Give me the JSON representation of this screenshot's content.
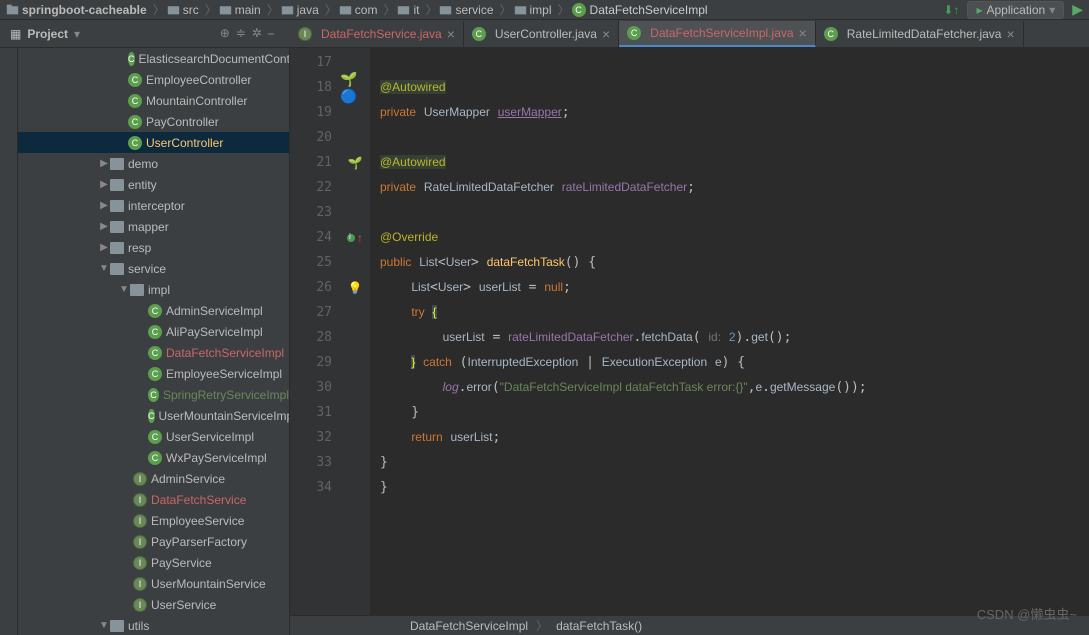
{
  "breadcrumbs": [
    "springboot-cacheable",
    "src",
    "main",
    "java",
    "com",
    "it",
    "service",
    "impl",
    "DataFetchServiceImpl"
  ],
  "runConfig": "Application",
  "projectTool": "Project",
  "tree": [
    {
      "ind": 110,
      "ic": "c",
      "lbl": "ElasticsearchDocumentController",
      "cls": ""
    },
    {
      "ind": 110,
      "ic": "c",
      "lbl": "EmployeeController",
      "cls": ""
    },
    {
      "ind": 110,
      "ic": "c",
      "lbl": "MountainController",
      "cls": ""
    },
    {
      "ind": 110,
      "ic": "c",
      "lbl": "PayController",
      "cls": ""
    },
    {
      "ind": 110,
      "ic": "c",
      "lbl": "UserController",
      "cls": "hl",
      "sel": true
    },
    {
      "ind": 80,
      "ic": "arr",
      "lbl": "demo",
      "fold": true
    },
    {
      "ind": 80,
      "ic": "arr",
      "lbl": "entity",
      "fold": true
    },
    {
      "ind": 80,
      "ic": "arr",
      "lbl": "interceptor",
      "fold": true
    },
    {
      "ind": 80,
      "ic": "arr",
      "lbl": "mapper",
      "fold": true
    },
    {
      "ind": 80,
      "ic": "arr",
      "lbl": "resp",
      "fold": true
    },
    {
      "ind": 80,
      "ic": "arrd",
      "lbl": "service",
      "fold": true
    },
    {
      "ind": 100,
      "ic": "arrd",
      "lbl": "impl",
      "fold": true
    },
    {
      "ind": 130,
      "ic": "c",
      "lbl": "AdminServiceImpl",
      "cls": ""
    },
    {
      "ind": 130,
      "ic": "c",
      "lbl": "AliPayServiceImpl",
      "cls": ""
    },
    {
      "ind": 130,
      "ic": "c",
      "lbl": "DataFetchServiceImpl",
      "cls": "err"
    },
    {
      "ind": 130,
      "ic": "c",
      "lbl": "EmployeeServiceImpl",
      "cls": ""
    },
    {
      "ind": 130,
      "ic": "c",
      "lbl": "SpringRetryServiceImpl",
      "cls": "grn"
    },
    {
      "ind": 130,
      "ic": "c",
      "lbl": "UserMountainServiceImpl",
      "cls": ""
    },
    {
      "ind": 130,
      "ic": "c",
      "lbl": "UserServiceImpl",
      "cls": ""
    },
    {
      "ind": 130,
      "ic": "c",
      "lbl": "WxPayServiceImpl",
      "cls": ""
    },
    {
      "ind": 115,
      "ic": "i",
      "lbl": "AdminService",
      "cls": ""
    },
    {
      "ind": 115,
      "ic": "i",
      "lbl": "DataFetchService",
      "cls": "err"
    },
    {
      "ind": 115,
      "ic": "i",
      "lbl": "EmployeeService",
      "cls": ""
    },
    {
      "ind": 115,
      "ic": "i",
      "lbl": "PayParserFactory",
      "cls": ""
    },
    {
      "ind": 115,
      "ic": "i",
      "lbl": "PayService",
      "cls": ""
    },
    {
      "ind": 115,
      "ic": "i",
      "lbl": "UserMountainService",
      "cls": ""
    },
    {
      "ind": 115,
      "ic": "i",
      "lbl": "UserService",
      "cls": ""
    },
    {
      "ind": 80,
      "ic": "arrd",
      "lbl": "utils",
      "fold": true
    }
  ],
  "tabs": [
    {
      "ic": "i",
      "name": "DataFetchService.java",
      "err": true
    },
    {
      "ic": "c",
      "name": "UserController.java"
    },
    {
      "ic": "c",
      "name": "DataFetchServiceImpl.java",
      "active": true,
      "err": true
    },
    {
      "ic": "c",
      "name": "RateLimitedDataFetcher.java"
    }
  ],
  "lineStart": 17,
  "lineEnd": 34,
  "code": {
    "l17": "@Autowired",
    "l18a": "private",
    "l18b": "UserMapper",
    "l18c": "userMapper",
    "l20": "@Autowired",
    "l21a": "private",
    "l21b": "RateLimitedDataFetcher",
    "l21c": "rateLimitedDataFetcher",
    "l23": "@Override",
    "l24a": "public",
    "l24b": "List",
    "l24c": "User",
    "l24d": "dataFetchTask",
    "l25a": "List",
    "l25b": "User",
    "l25c": "userList",
    "l25d": "null",
    "l26": "try",
    "l27a": "userList",
    "l27b": "rateLimitedDataFetcher",
    "l27c": "fetchData",
    "l27d": "id:",
    "l27e": "2",
    "l27f": "get",
    "l28a": "catch",
    "l28b": "InterruptedException",
    "l28c": "ExecutionException",
    "l28d": "e",
    "l29a": "log",
    "l29b": "error",
    "l29c": "\"DataFetchServiceImpl dataFetchTask error:{}\"",
    "l29d": "e",
    "l29e": "getMessage",
    "l31a": "return",
    "l31b": "userList"
  },
  "bottomCrumbs": [
    "DataFetchServiceImpl",
    "dataFetchTask()"
  ],
  "watermark": "CSDN @懒虫虫~"
}
